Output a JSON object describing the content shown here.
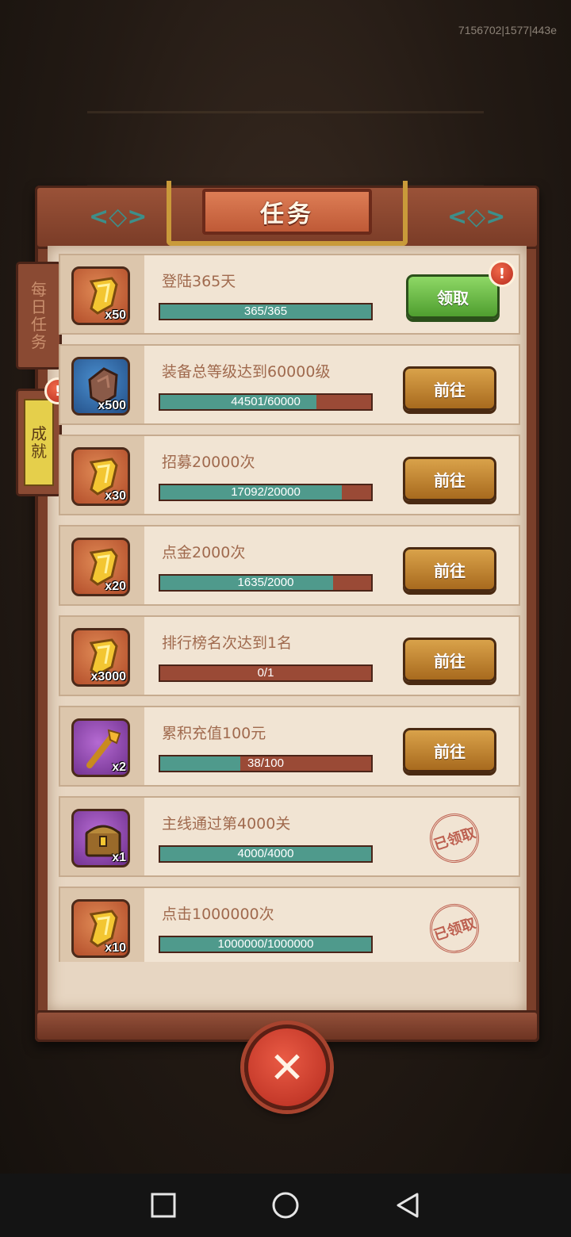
{
  "build_id": "7156702|1577|443e",
  "title": "任务",
  "side_tabs": {
    "daily": "每日任务",
    "achievement": "成就",
    "achievement_badge": "!"
  },
  "colors": {
    "progress_fill": "#4f9a8c",
    "progress_track": "#9a4a36",
    "go_button": "#c0842f",
    "claim_button": "#6fc04a",
    "stamp": "#b54a3a"
  },
  "tasks": [
    {
      "title": "登陆365天",
      "reward_icon": "gold-scroll-icon",
      "reward_qty": "x50",
      "progress_text": "365/365",
      "progress": 1.0,
      "action": "领取",
      "action_type": "claim",
      "badge": "!"
    },
    {
      "title": "装备总等级达到60000级",
      "reward_icon": "ore-stone-icon",
      "reward_qty": "x500",
      "progress_text": "44501/60000",
      "progress": 0.742,
      "action": "前往",
      "action_type": "go"
    },
    {
      "title": "招募20000次",
      "reward_icon": "gold-scroll-icon",
      "reward_qty": "x30",
      "progress_text": "17092/20000",
      "progress": 0.855,
      "action": "前往",
      "action_type": "go"
    },
    {
      "title": "点金2000次",
      "reward_icon": "gold-scroll-icon",
      "reward_qty": "x20",
      "progress_text": "1635/2000",
      "progress": 0.818,
      "action": "前往",
      "action_type": "go"
    },
    {
      "title": "排行榜名次达到1名",
      "reward_icon": "gold-scroll-icon",
      "reward_qty": "x3000",
      "progress_text": "0/1",
      "progress": 0.0,
      "action": "前往",
      "action_type": "go"
    },
    {
      "title": "累积充值100元",
      "reward_icon": "golden-staff-icon",
      "reward_qty": "x2",
      "progress_text": "38/100",
      "progress": 0.38,
      "action": "前往",
      "action_type": "go"
    },
    {
      "title": "主线通过第4000关",
      "reward_icon": "treasure-chest-icon",
      "reward_qty": "x1",
      "progress_text": "4000/4000",
      "progress": 1.0,
      "action": "已领取",
      "action_type": "claimed"
    },
    {
      "title": "点击1000000次",
      "reward_icon": "gold-scroll-icon",
      "reward_qty": "x10",
      "progress_text": "1000000/1000000",
      "progress": 1.0,
      "action": "已领取",
      "action_type": "claimed"
    }
  ],
  "close_label": "✕",
  "nav": [
    "recent-apps",
    "home",
    "back"
  ]
}
